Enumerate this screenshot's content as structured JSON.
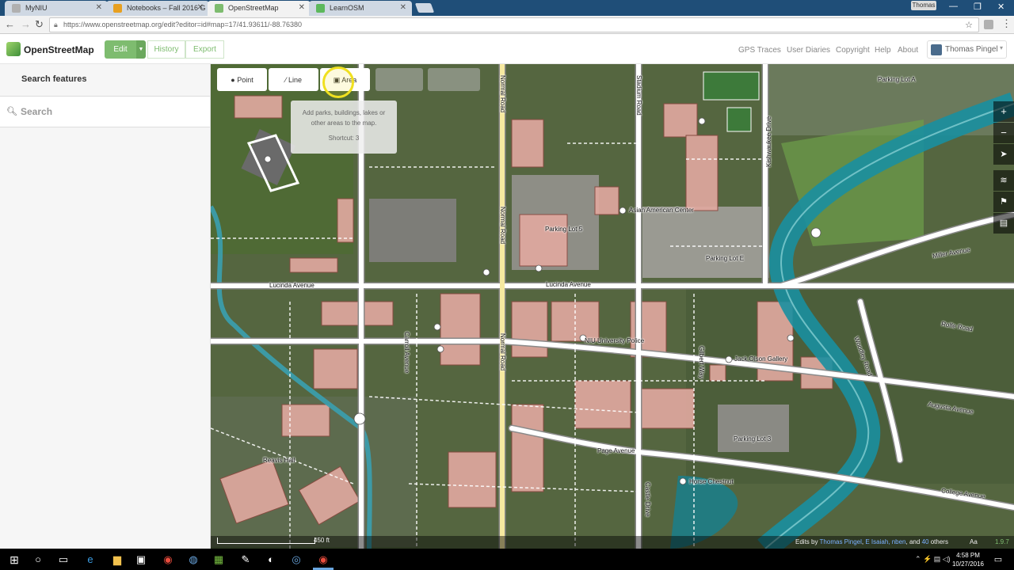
{
  "browser": {
    "tabs": [
      {
        "title": "MyNIU",
        "fav_color": "#b0b0b0"
      },
      {
        "title": "Notebooks – Fall 2016 G",
        "fav_color": "#e8a020"
      },
      {
        "title": "OpenStreetMap",
        "fav_color": "#7ebc6f"
      },
      {
        "title": "LearnOSM",
        "fav_color": "#5cb85c"
      }
    ],
    "user_badge": "Thomas",
    "url": "https://www.openstreetmap.org/edit?editor=id#map=17/41.93611/-88.76380"
  },
  "header": {
    "brand": "OpenStreetMap",
    "edit_label": "Edit",
    "history_label": "History",
    "export_label": "Export",
    "links": [
      "GPS Traces",
      "User Diaries",
      "Copyright",
      "Help",
      "About"
    ],
    "user_name": "Thomas Pingel"
  },
  "sidebar": {
    "heading": "Search features",
    "search_placeholder": "Search"
  },
  "map": {
    "tools": {
      "point": "Point",
      "line": "Line",
      "area": "Area"
    },
    "tooltip": {
      "text": "Add parks, buildings, lakes or other areas to the map.",
      "shortcut": "Shortcut: 3"
    },
    "labels": {
      "parking_lot_a": "Parking Lot A",
      "asian_american_center": "Asian American Center",
      "parking_lot_5": "Parking Lot 5",
      "parking_lot_e": "Parking Lot E",
      "miller_avenue": "Miller Avenue",
      "lucinda_avenue_left": "Lucinda Avenue",
      "lucinda_avenue_mid": "Lucinda Avenue",
      "rolfe_road": "Rolfe Road",
      "niu_police": "NIU University Police",
      "jack_olson_gallery": "Jack Olson Gallery",
      "woodley_road": "Woodley Road",
      "augusta_avenue": "Augusta Avenue",
      "parking_lot_3": "Parking Lot 3",
      "page_avenue": "Page Avenue",
      "horse_chestnut": "Horse Chestnut",
      "college_avenue": "College Avenue",
      "reavis_hall": "Reavis Hall",
      "normal_road": "Normal Road",
      "carroll_avenue": "Carroll Avenue",
      "kishwaukee_drive": "Kishwaukee Drive",
      "gilbert_way": "Gilbert Way",
      "castle_drive": "Castle Drive",
      "stadium_road": "Stadium Road"
    },
    "footer": {
      "scale": "450 ft",
      "edits_prefix": "Edits by",
      "editor_1": "Thomas Pingel",
      "editor_2": "E Isaiah, nben",
      "and_text": "and",
      "others_count": "40",
      "others_text": "others",
      "aa": "Aa",
      "version": "1.9.7"
    },
    "colors": {
      "road": "#ffffff",
      "casing": "#9a9a9a",
      "building": "#e0a8a0",
      "water": "#1a8fa0",
      "main_road": "#f6e9a0"
    }
  },
  "taskbar": {
    "time": "4:58 PM",
    "date": "10/27/2016"
  }
}
